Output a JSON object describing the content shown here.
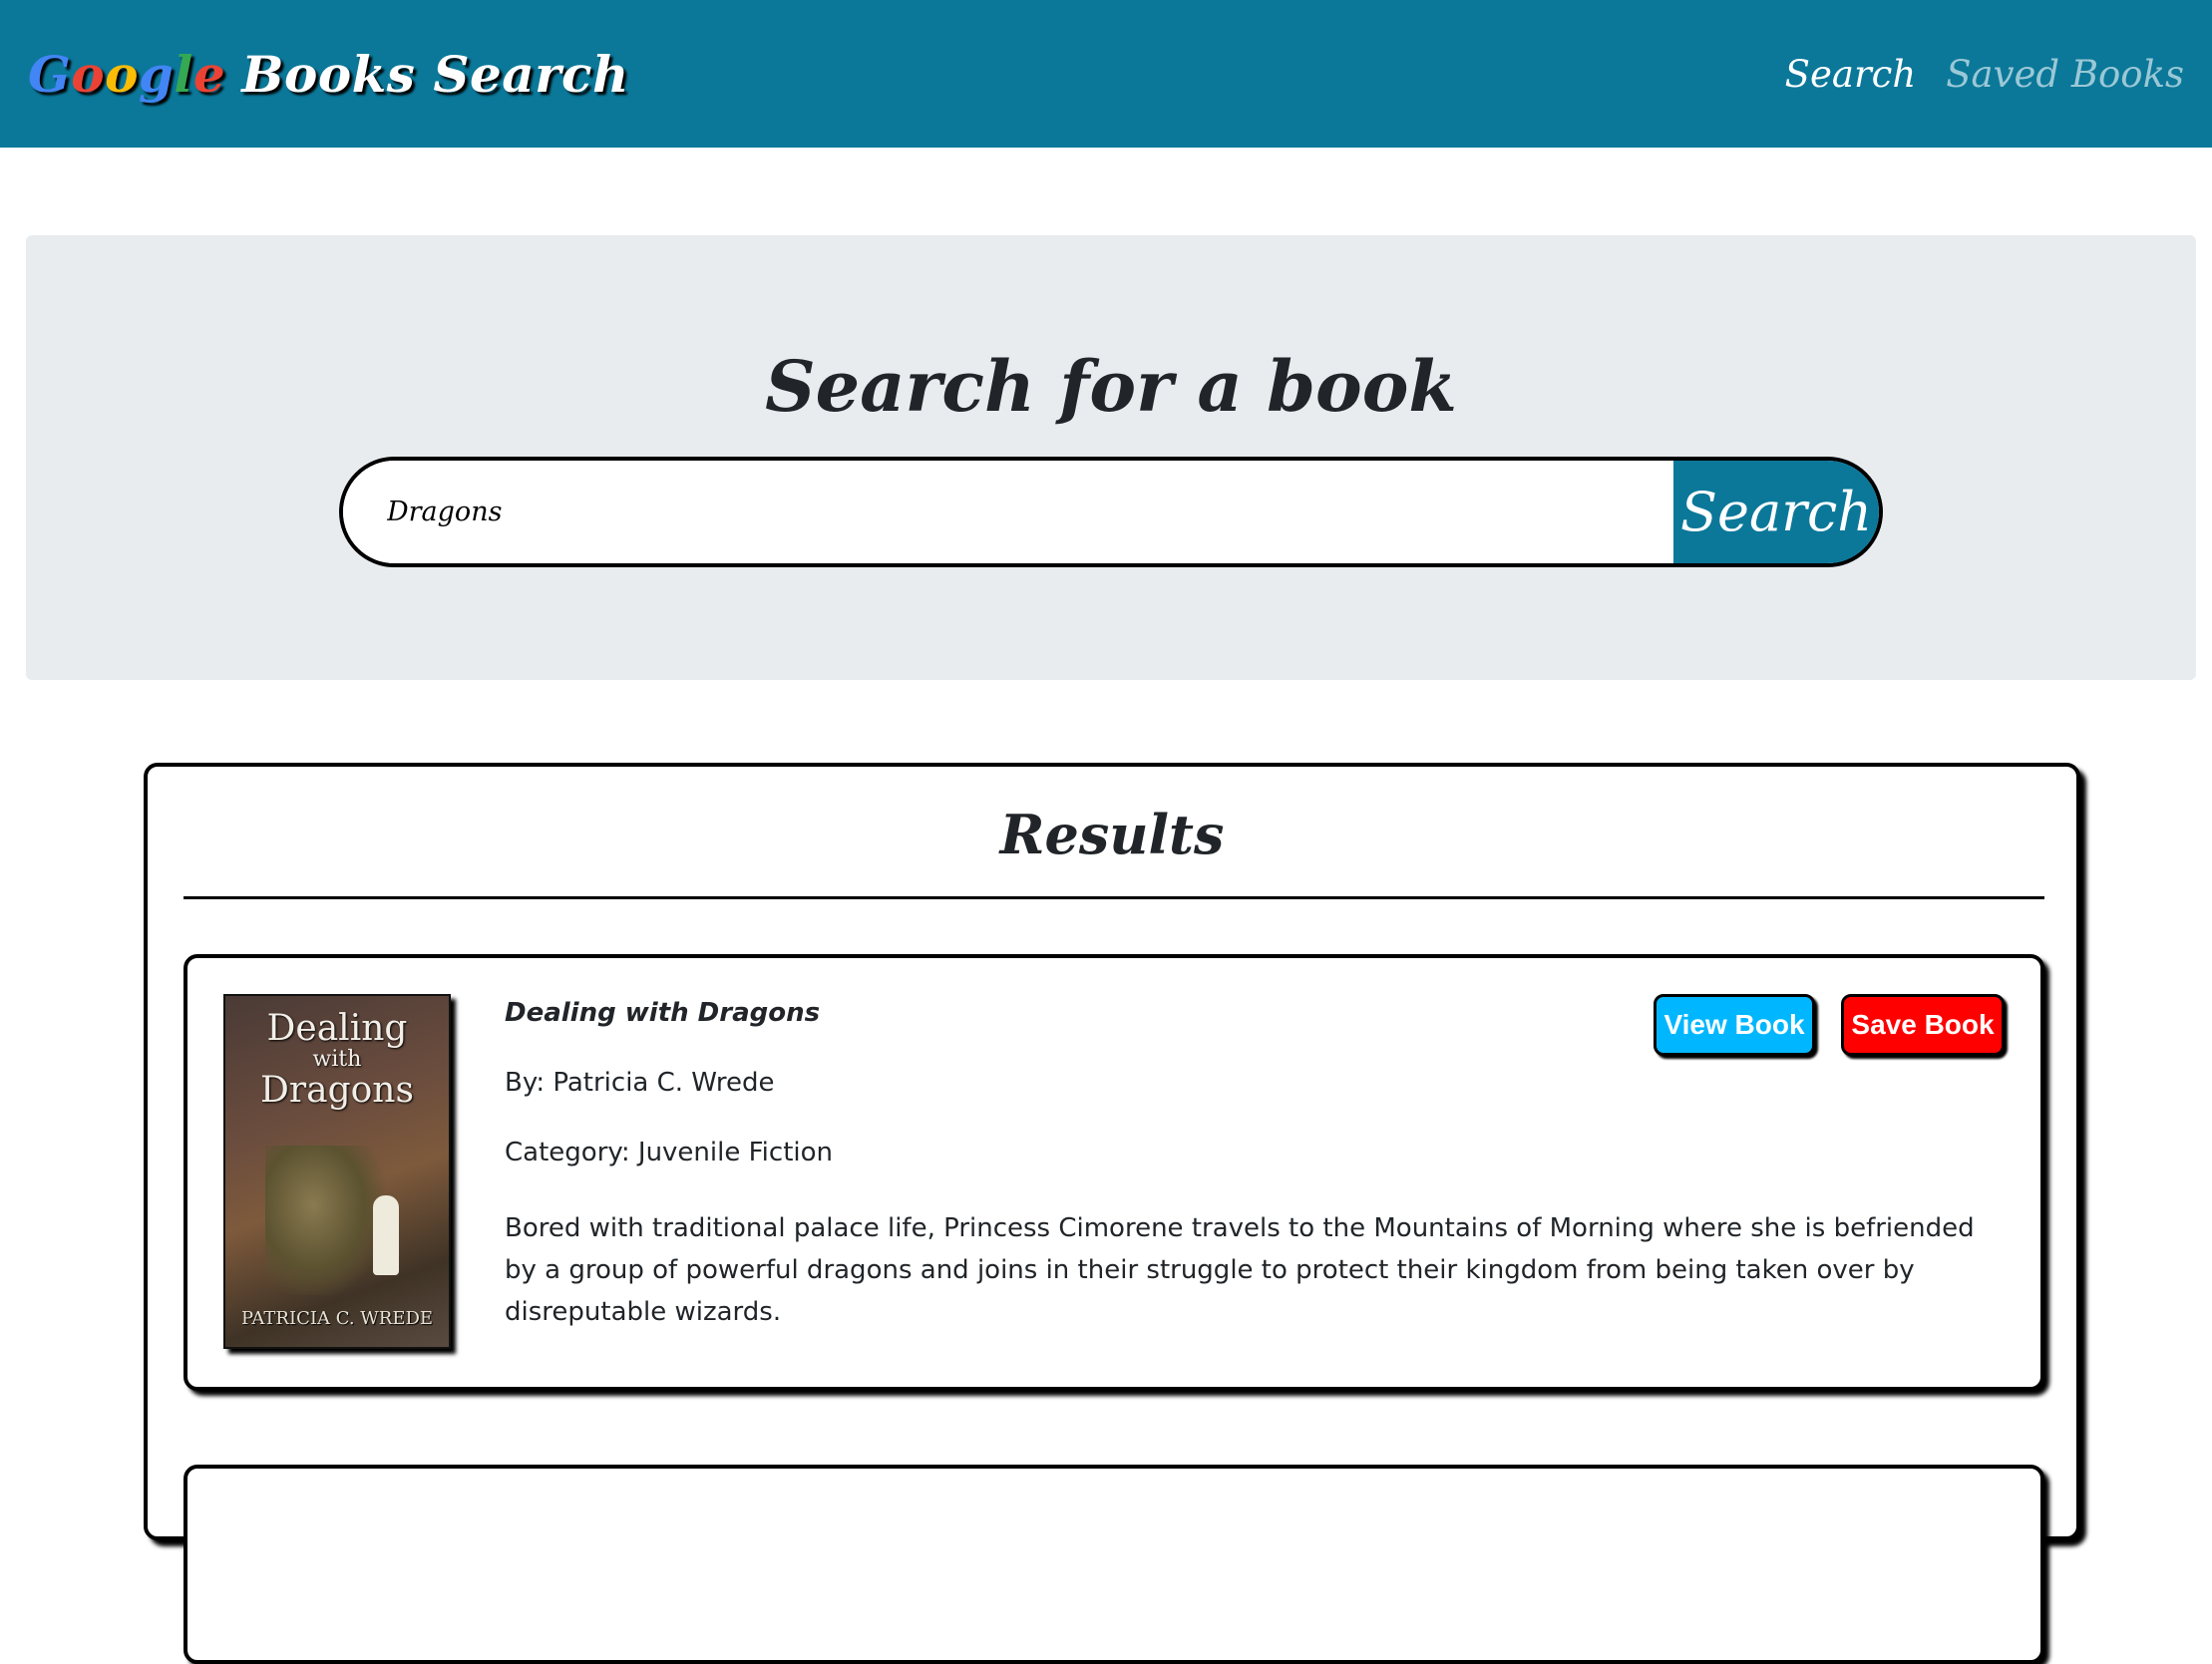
{
  "navbar": {
    "brand_google": [
      "G",
      "o",
      "o",
      "g",
      "l",
      "e"
    ],
    "brand_rest": "Books Search",
    "links": [
      {
        "label": "Search",
        "active": true
      },
      {
        "label": "Saved Books",
        "active": false
      }
    ]
  },
  "search": {
    "title": "Search for a book",
    "input_value": "Dragons",
    "button_label": "Search"
  },
  "results": {
    "title": "Results",
    "books": [
      {
        "title": "Dealing with Dragons",
        "author": "By: Patricia C. Wrede",
        "category": "Category: Juvenile Fiction",
        "description": "Bored with traditional palace life, Princess Cimorene travels to the Mountains of Morning where she is befriended by a group of powerful dragons and joins in their struggle to protect their kingdom from being taken over by disreputable wizards.",
        "cover": {
          "title_line1": "Dealing",
          "title_line2": "with",
          "title_line3": "Dragons",
          "author": "PATRICIA C. WREDE"
        },
        "view_label": "View Book",
        "save_label": "Save Book"
      }
    ]
  },
  "colors": {
    "navbar": "#0b7899",
    "view_button": "#00b7ff",
    "save_button": "#ff0000",
    "jumbotron": "#e8ecef"
  }
}
